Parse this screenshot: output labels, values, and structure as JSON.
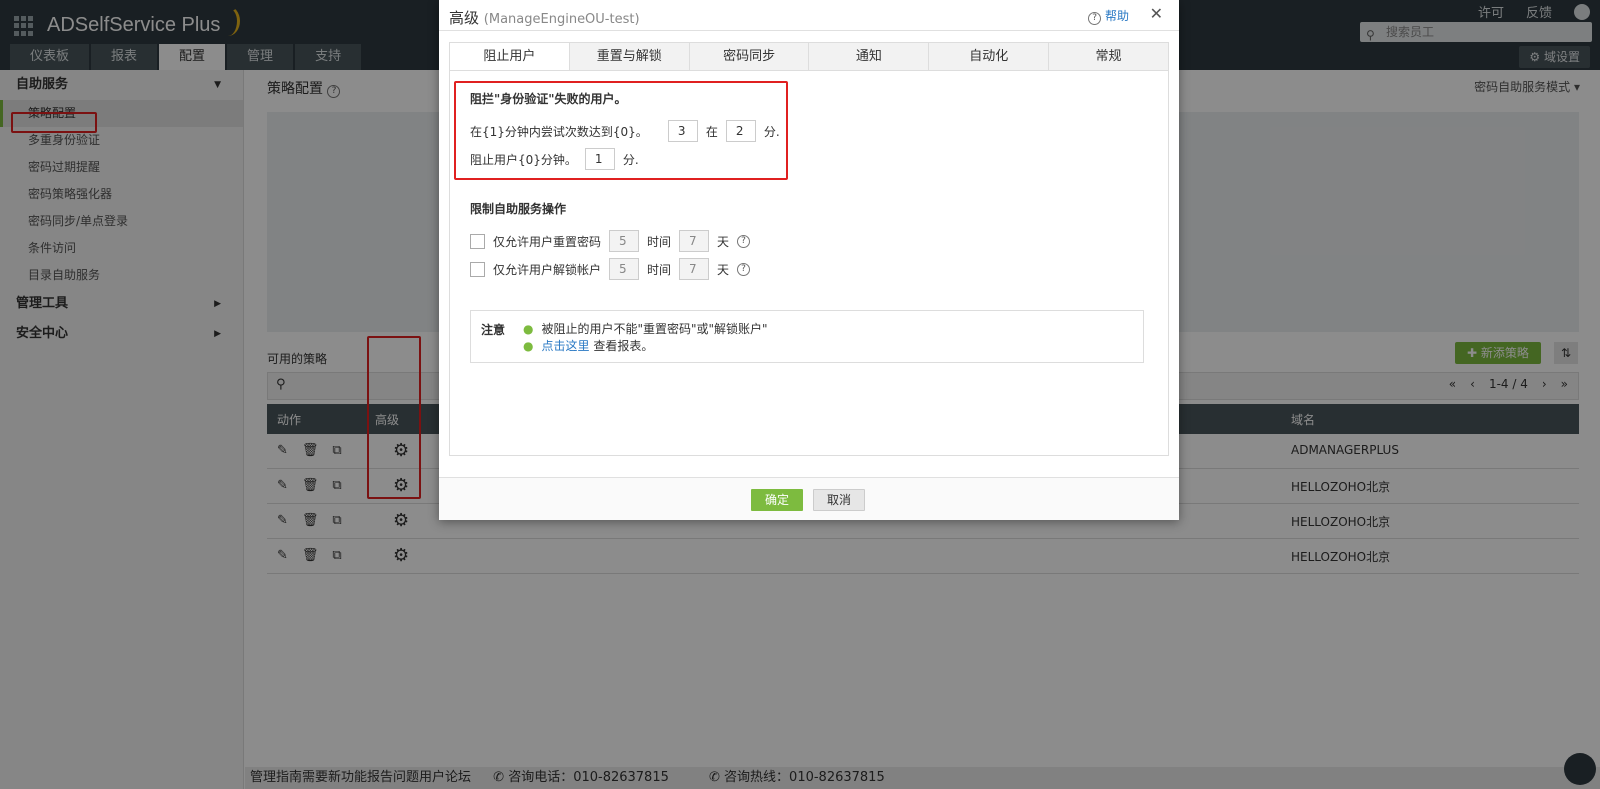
{
  "app": {
    "title": "ADSelfService Plus"
  },
  "nav": {
    "tabs": [
      "仪表板",
      "报表",
      "配置",
      "管理",
      "支持"
    ]
  },
  "topright": {
    "license": "许可",
    "feedback": "反馈",
    "search_placeholder": "搜索员工",
    "domain_settings": "域设置"
  },
  "sidebar": {
    "section1": "自助服务",
    "items": [
      "策略配置",
      "多重身份验证",
      "密码过期提醒",
      "密码策略强化器",
      "密码同步/单点登录",
      "条件访问",
      "目录自助服务"
    ],
    "section2": "管理工具",
    "section3": "安全中心"
  },
  "main": {
    "title": "策略配置",
    "mode": "密码自助服务模式",
    "policies_label": "可用的策略",
    "new_policy": "新添策略",
    "pager": "1-4 / 4",
    "headers": {
      "actions": "动作",
      "advanced": "高级",
      "domain": "域名"
    },
    "rows": [
      {
        "domain": "ADMANAGERPLUS"
      },
      {
        "domain": "HELLOZOHO北京"
      },
      {
        "domain": "HELLOZOHO北京"
      },
      {
        "domain": "HELLOZOHO北京"
      }
    ]
  },
  "footer": {
    "links": "管理指南需要新功能报告问题用户论坛",
    "phone": "咨询电话：010-82637815",
    "hotline": "咨询热线：010-82637815"
  },
  "dialog": {
    "title": "高级",
    "subtitle": "(ManageEngineOU-test)",
    "help": "帮助",
    "tabs": [
      "阻止用户",
      "重置与解锁",
      "密码同步",
      "通知",
      "自动化",
      "常规"
    ],
    "block": {
      "title": "阻拦\"身份验证\"失败的用户。",
      "line1_text": "在{1}分钟内尝试次数达到{0}。",
      "attempts": "3",
      "in": "在",
      "minutes": "2",
      "unit": "分.",
      "line2_text": "阻止用户{0}分钟。",
      "block_minutes": "1"
    },
    "limit": {
      "title": "限制自助服务操作",
      "reset_label": "仅允许用户重置密码",
      "reset_count": "5",
      "time": "时间",
      "reset_days": "7",
      "day": "天",
      "unlock_label": "仅允许用户解锁帐户",
      "unlock_count": "5",
      "unlock_days": "7"
    },
    "note": {
      "label": "注意",
      "item1": "被阻止的用户不能\"重置密码\"或\"解锁账户\"",
      "link": "点击这里",
      "item2_rest": " 查看报表。"
    },
    "ok": "确定",
    "cancel": "取消"
  },
  "colors": {
    "accent": "#7dbb3f",
    "header": "#2f3a40",
    "highlight": "#e02020",
    "link": "#2a79c4"
  }
}
